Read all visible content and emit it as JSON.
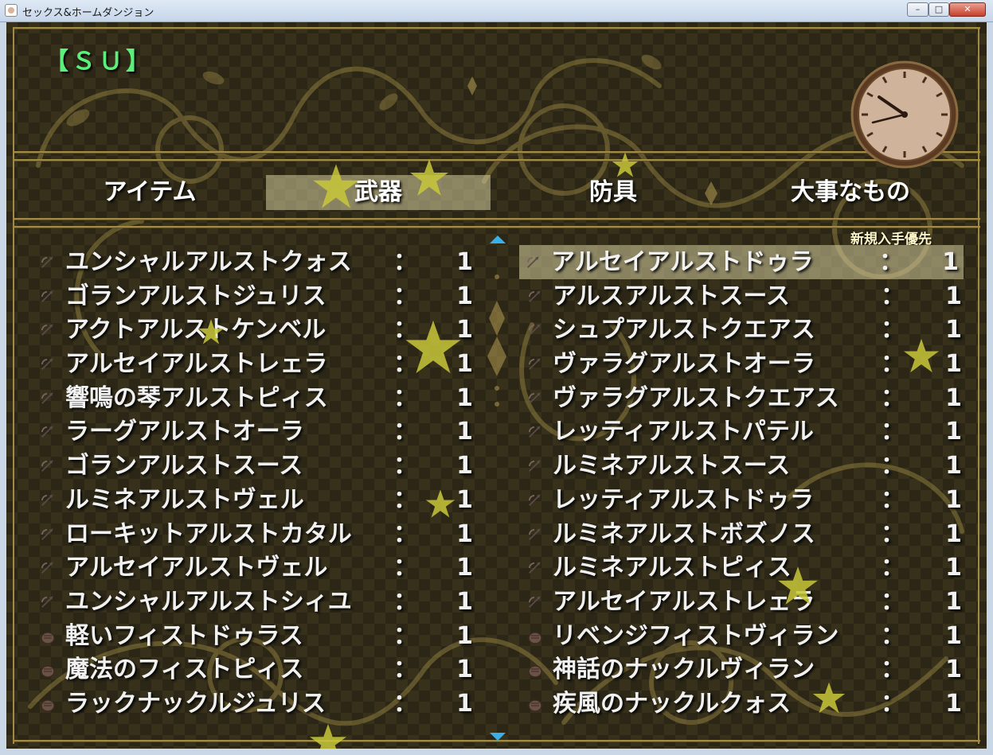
{
  "window": {
    "title": "セックス&ホームダンジョン",
    "minimize": "–",
    "maximize": "□",
    "close": "✕"
  },
  "status": {
    "character_name": "【ＳＵ】"
  },
  "tabs": [
    "アイテム",
    "武器",
    "防具",
    "大事なもの"
  ],
  "selected_tab": "武器",
  "sort_label": "新規入手優先",
  "colors": {
    "accent_name": "#5af07a",
    "selection": "#d7cda0",
    "frame": "#a08a45",
    "arrow": "#39b0e8"
  },
  "left_list": [
    {
      "icon": "bow-icon",
      "name": "ユンシャルアルストクォス",
      "sep": "：",
      "qty": "1"
    },
    {
      "icon": "bow-icon",
      "name": "ゴランアルストジュリス",
      "sep": "：",
      "qty": "1"
    },
    {
      "icon": "bow-icon",
      "name": "アクトアルストケンベル",
      "sep": "：",
      "qty": "1"
    },
    {
      "icon": "bow-icon",
      "name": "アルセイアルストレェラ",
      "sep": "：",
      "qty": "1"
    },
    {
      "icon": "bow-icon",
      "name": "響鳴の琴アルストピィス",
      "sep": "：",
      "qty": "1"
    },
    {
      "icon": "bow-icon",
      "name": "ラーグアルストオーラ",
      "sep": "：",
      "qty": "1"
    },
    {
      "icon": "bow-icon",
      "name": "ゴランアルストスース",
      "sep": "：",
      "qty": "1"
    },
    {
      "icon": "bow-icon",
      "name": "ルミネアルストヴェル",
      "sep": "：",
      "qty": "1"
    },
    {
      "icon": "bow-icon",
      "name": "ローキットアルストカタル",
      "sep": "：",
      "qty": "1"
    },
    {
      "icon": "bow-icon",
      "name": "アルセイアルストヴェル",
      "sep": "：",
      "qty": "1"
    },
    {
      "icon": "bow-icon",
      "name": "ユンシャルアルストシィユ",
      "sep": "：",
      "qty": "1"
    },
    {
      "icon": "fist-icon",
      "name": "軽いフィストドゥラス",
      "sep": "：",
      "qty": "1"
    },
    {
      "icon": "fist-icon",
      "name": "魔法のフィストピィス",
      "sep": "：",
      "qty": "1"
    },
    {
      "icon": "fist-icon",
      "name": "ラックナックルジュリス",
      "sep": "：",
      "qty": "1"
    }
  ],
  "right_list": [
    {
      "icon": "bow-icon",
      "name": "アルセイアルストドゥラ",
      "sep": "：",
      "qty": "1",
      "selected": true
    },
    {
      "icon": "bow-icon",
      "name": "アルスアルストスース",
      "sep": "：",
      "qty": "1"
    },
    {
      "icon": "bow-icon",
      "name": "シュプアルストクエアス",
      "sep": "：",
      "qty": "1"
    },
    {
      "icon": "bow-icon",
      "name": "ヴァラグアルストオーラ",
      "sep": "：",
      "qty": "1"
    },
    {
      "icon": "bow-icon",
      "name": "ヴァラグアルストクエアス",
      "sep": "：",
      "qty": "1"
    },
    {
      "icon": "bow-icon",
      "name": "レッティアルストパテル",
      "sep": "：",
      "qty": "1"
    },
    {
      "icon": "bow-icon",
      "name": "ルミネアルストスース",
      "sep": "：",
      "qty": "1"
    },
    {
      "icon": "bow-icon",
      "name": "レッティアルストドゥラ",
      "sep": "：",
      "qty": "1"
    },
    {
      "icon": "bow-icon",
      "name": "ルミネアルストボズノス",
      "sep": "：",
      "qty": "1"
    },
    {
      "icon": "bow-icon",
      "name": "ルミネアルストピィス",
      "sep": "：",
      "qty": "1"
    },
    {
      "icon": "bow-icon",
      "name": "アルセイアルストレェラ",
      "sep": "：",
      "qty": "1"
    },
    {
      "icon": "fist-icon",
      "name": "リベンジフィストヴィラン",
      "sep": "：",
      "qty": "1"
    },
    {
      "icon": "fist-icon",
      "name": "神話のナックルヴィラン",
      "sep": "：",
      "qty": "1"
    },
    {
      "icon": "fist-icon",
      "name": "疾風のナックルクォス",
      "sep": "：",
      "qty": "1"
    }
  ]
}
